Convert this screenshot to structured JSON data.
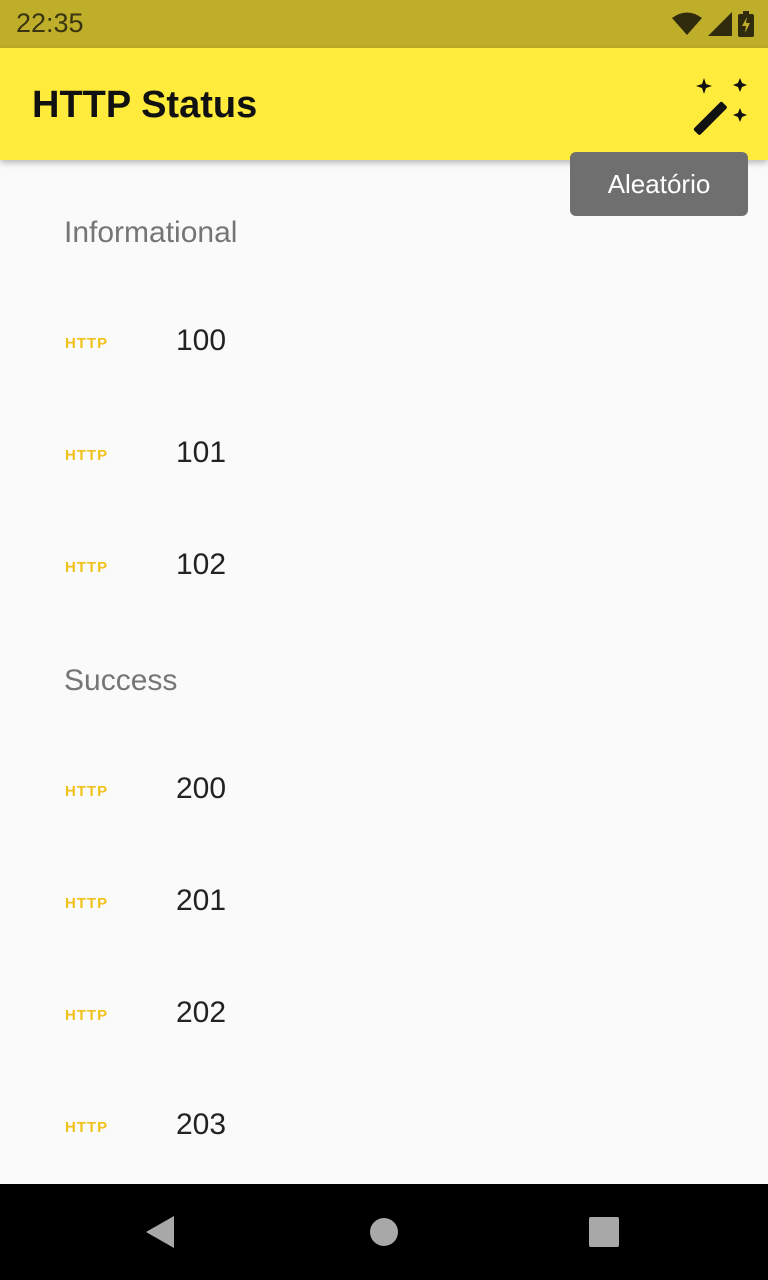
{
  "status_bar": {
    "time": "22:35",
    "icons": [
      "wifi-icon",
      "signal-icon",
      "battery-charging-icon"
    ]
  },
  "app_bar": {
    "title": "HTTP Status",
    "action_icon": "magic-wand-icon"
  },
  "tooltip": {
    "text": "Aleatório"
  },
  "sections": [
    {
      "title": "Informational",
      "items": [
        {
          "tag": "HTTP",
          "code": "100"
        },
        {
          "tag": "HTTP",
          "code": "101"
        },
        {
          "tag": "HTTP",
          "code": "102"
        }
      ]
    },
    {
      "title": "Success",
      "items": [
        {
          "tag": "HTTP",
          "code": "200"
        },
        {
          "tag": "HTTP",
          "code": "201"
        },
        {
          "tag": "HTTP",
          "code": "202"
        },
        {
          "tag": "HTTP",
          "code": "203"
        }
      ]
    }
  ],
  "nav_bar": {
    "icons": [
      "back-icon",
      "home-icon",
      "recents-icon"
    ]
  },
  "colors": {
    "status_bar": "#bfae2a",
    "app_bar": "#ffeb3b",
    "http_tag": "#f2c21c",
    "tooltip": "#6f6f6f"
  }
}
